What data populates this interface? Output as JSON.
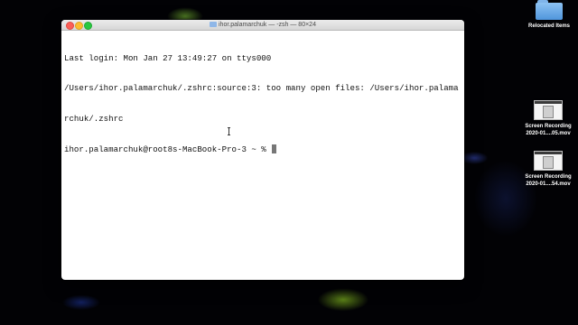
{
  "terminal": {
    "title": "ihor.palamarchuk — -zsh — 80×24",
    "lines": [
      "Last login: Mon Jan 27 13:49:27 on ttys000",
      "/Users/ihor.palamarchuk/.zshrc:source:3: too many open files: /Users/ihor.palama",
      "rchuk/.zshrc",
      "ihor.palamarchuk@root8s-MacBook-Pro-3 ~ % "
    ]
  },
  "desktop": {
    "icons": [
      {
        "name": "Relocated Items",
        "icon": "folder-icon"
      },
      {
        "name_line1": "Screen Recording",
        "name_line2": "2020-01....05.mov",
        "icon": "video-thumbnail-icon"
      },
      {
        "name_line1": "Screen Recording",
        "name_line2": "2020-01....54.mov",
        "icon": "video-thumbnail-icon"
      }
    ]
  },
  "colors": {
    "close": "#fc5f57",
    "minimize": "#fdbc2e",
    "zoom": "#28c840"
  }
}
